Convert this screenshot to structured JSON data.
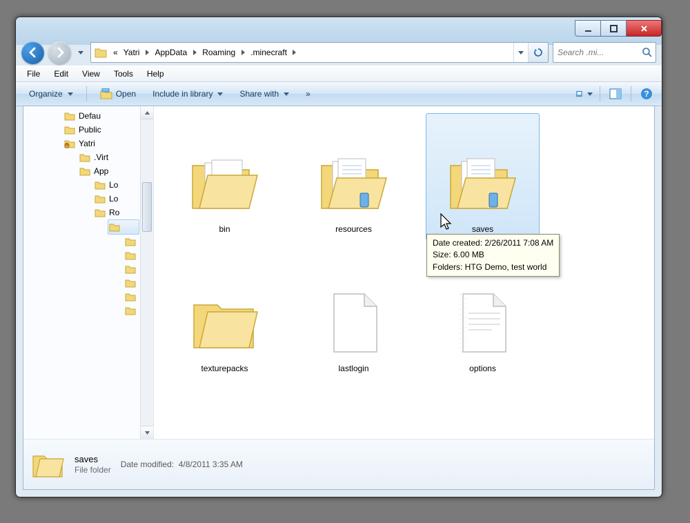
{
  "breadcrumb": {
    "overflow": "«",
    "items": [
      "Yatri",
      "AppData",
      "Roaming",
      ".minecraft"
    ]
  },
  "search": {
    "placeholder": "Search .mi..."
  },
  "menubar": [
    "File",
    "Edit",
    "View",
    "Tools",
    "Help"
  ],
  "cmdbar": {
    "organize": "Organize",
    "open": "Open",
    "include": "Include in library",
    "share": "Share with",
    "overflow": "»"
  },
  "tree": {
    "items": [
      {
        "label": "Defau",
        "indent": 58,
        "lock": false
      },
      {
        "label": "Public",
        "indent": 58,
        "lock": false
      },
      {
        "label": "Yatri",
        "indent": 58,
        "lock": true
      },
      {
        "label": ".Virt",
        "indent": 80,
        "lock": false
      },
      {
        "label": "App",
        "indent": 80,
        "lock": false
      },
      {
        "label": "Lo",
        "indent": 102,
        "lock": false
      },
      {
        "label": "Lo",
        "indent": 102,
        "lock": false
      },
      {
        "label": "Ro",
        "indent": 102,
        "lock": false
      },
      {
        "label": "",
        "indent": 124,
        "lock": false,
        "sel": true
      },
      {
        "label": "",
        "indent": 146,
        "lock": false
      },
      {
        "label": "",
        "indent": 146,
        "lock": false
      },
      {
        "label": "",
        "indent": 146,
        "lock": false
      },
      {
        "label": "",
        "indent": 146,
        "lock": false
      },
      {
        "label": "",
        "indent": 146,
        "lock": false
      },
      {
        "label": "",
        "indent": 146,
        "lock": false
      }
    ]
  },
  "content": {
    "items": [
      {
        "name": "bin",
        "kind": "folder-open",
        "sel": false
      },
      {
        "name": "resources",
        "kind": "folder-docs",
        "sel": false
      },
      {
        "name": "saves",
        "kind": "folder-docs",
        "sel": true
      },
      {
        "name": "texturepacks",
        "kind": "folder",
        "sel": false
      },
      {
        "name": "lastlogin",
        "kind": "file",
        "sel": false
      },
      {
        "name": "options",
        "kind": "file-text",
        "sel": false
      }
    ]
  },
  "tooltip": {
    "line1": "Date created: 2/26/2011 7:08 AM",
    "line2": "Size: 6.00 MB",
    "line3": "Folders: HTG Demo, test world"
  },
  "details": {
    "name": "saves",
    "type": "File folder",
    "mod_label": "Date modified:",
    "mod_value": "4/8/2011 3:35 AM"
  }
}
